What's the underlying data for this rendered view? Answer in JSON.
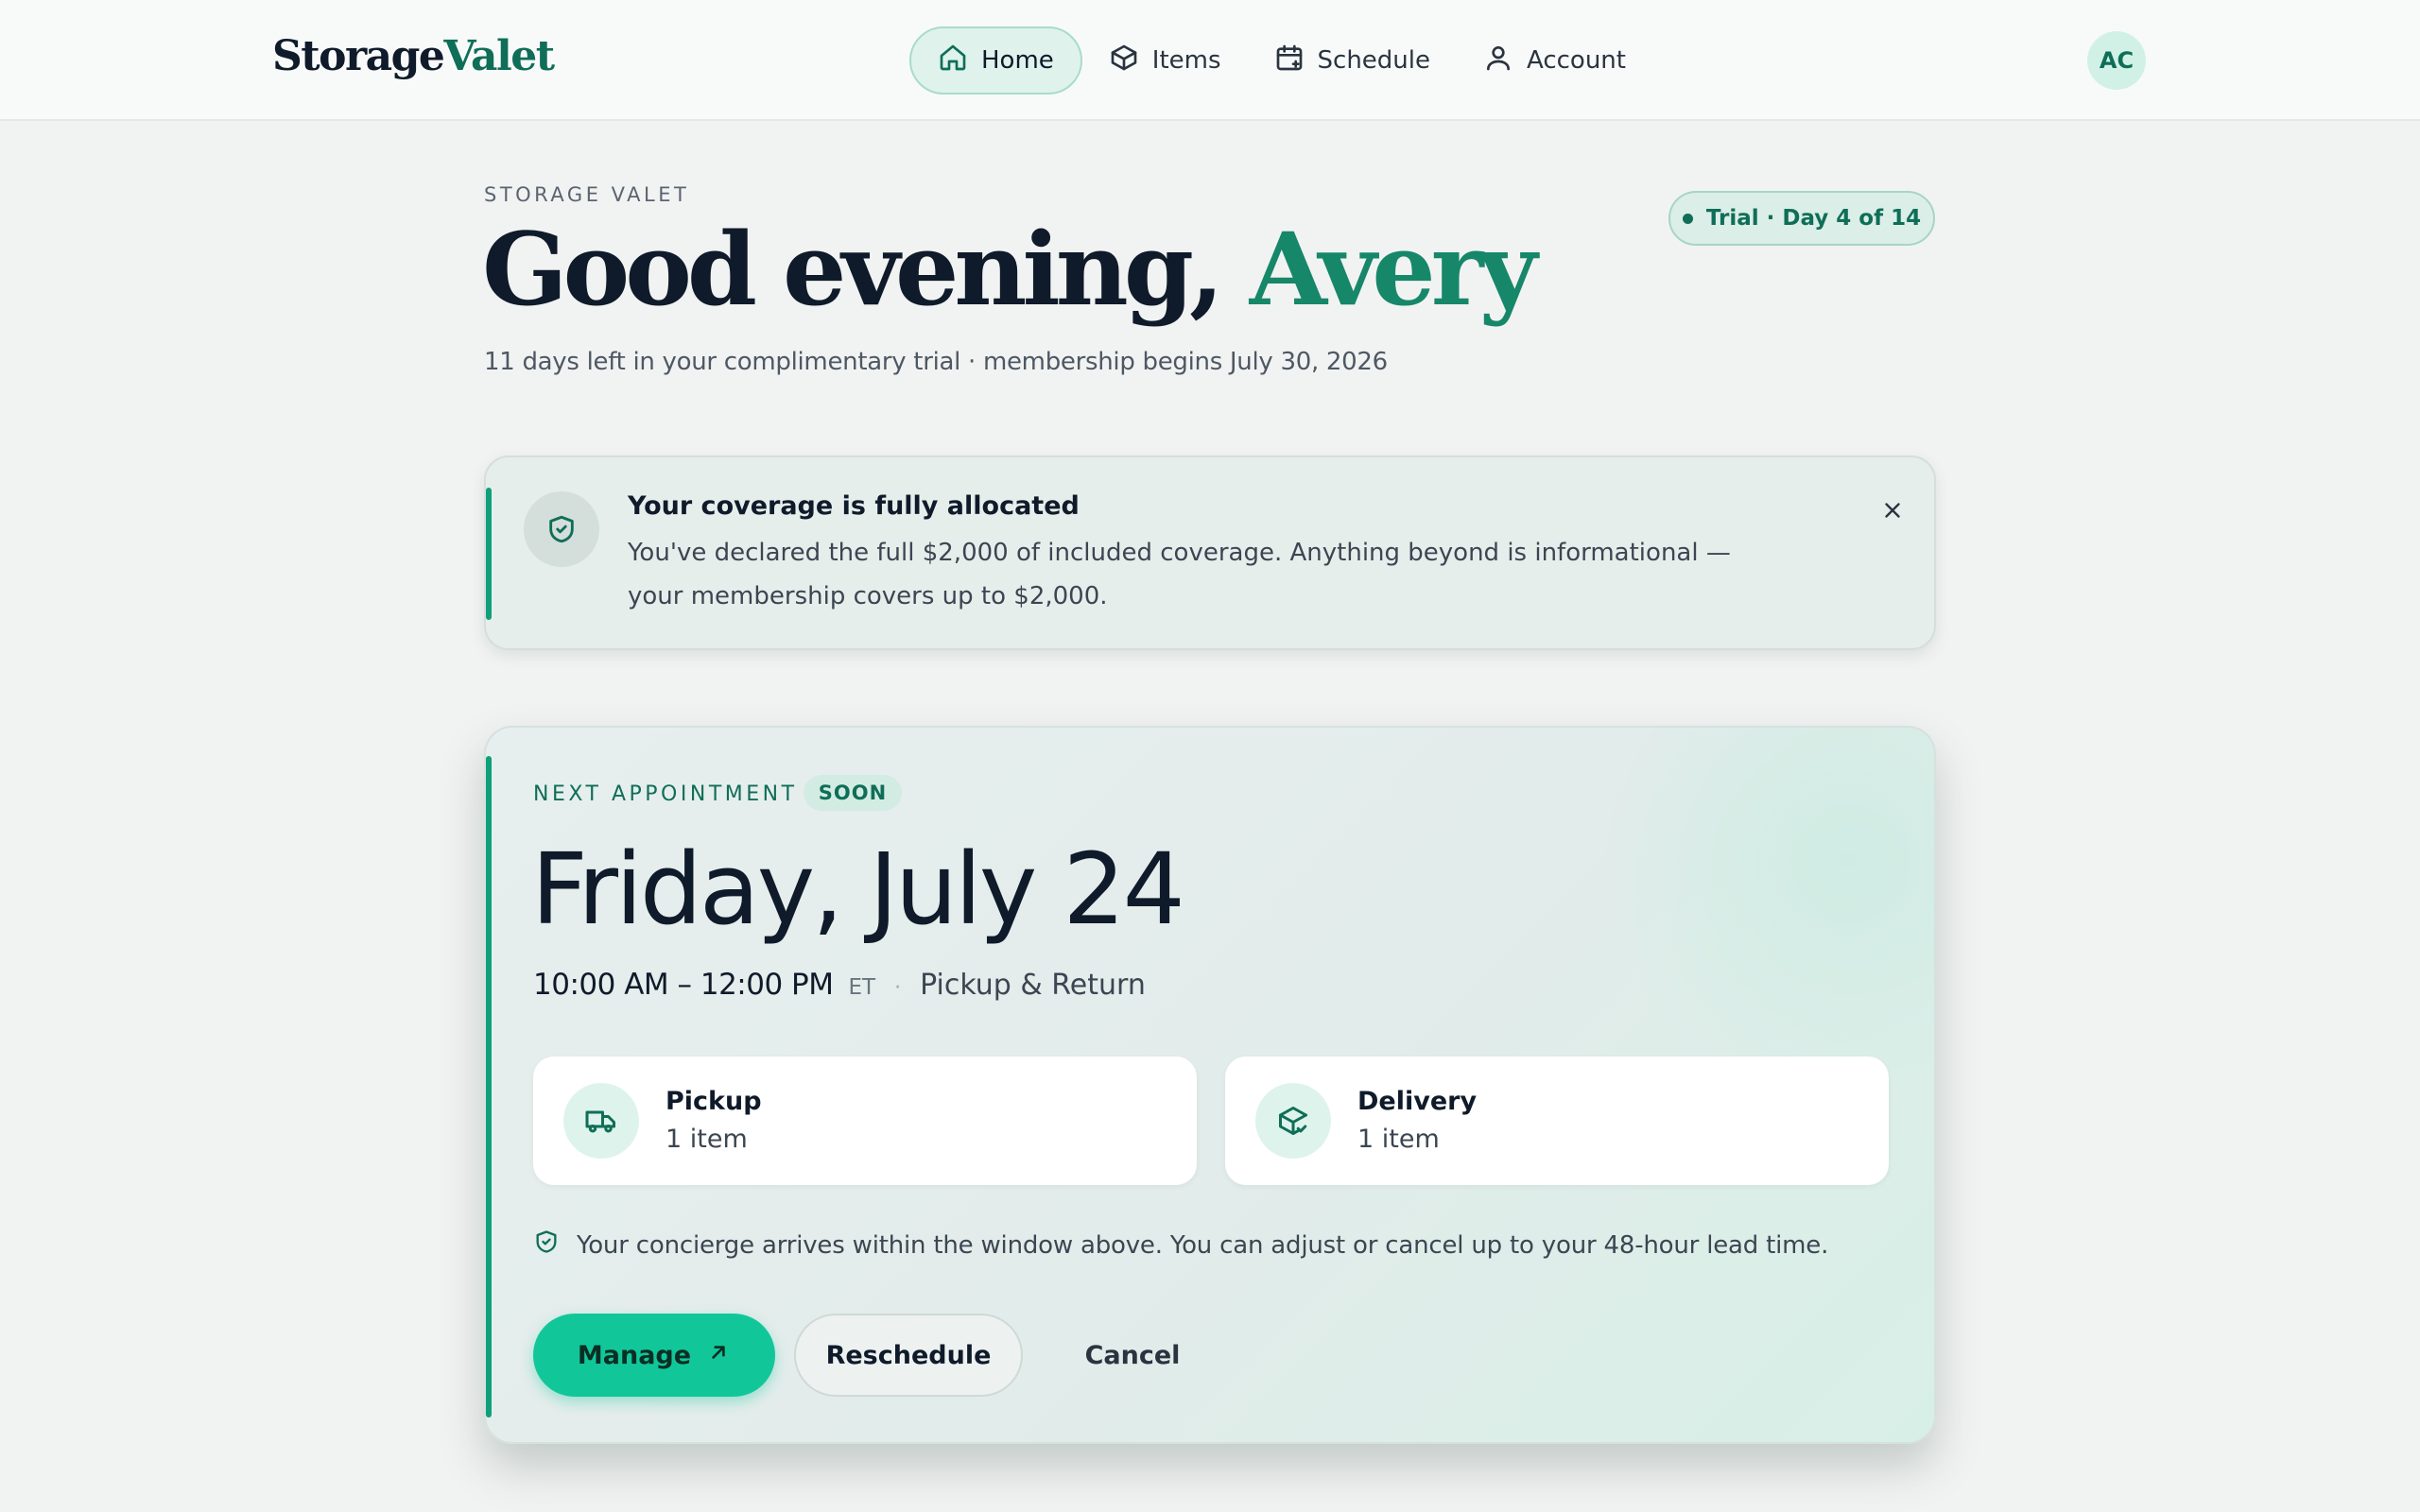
{
  "header": {
    "logo": {
      "part1": "Storage",
      "part2": "Valet"
    },
    "nav": [
      {
        "label": "Home",
        "icon": "home-icon",
        "active": true
      },
      {
        "label": "Items",
        "icon": "box-icon",
        "active": false
      },
      {
        "label": "Schedule",
        "icon": "calendar-icon",
        "active": false
      },
      {
        "label": "Account",
        "icon": "user-icon",
        "active": false
      }
    ],
    "avatar_initials": "AC"
  },
  "greeting": {
    "eyebrow": "STORAGE VALET",
    "salutation": "Good evening,",
    "name": "Avery",
    "subline": "11 days left in your complimentary trial · membership begins July 30, 2026",
    "trial_badge": "Trial · Day 4 of 14"
  },
  "alert": {
    "icon": "shield-check-icon",
    "title": "Your coverage is fully allocated",
    "body": "You've declared the full $2,000 of included coverage. Anything beyond is informational — your membership covers up to $2,000.",
    "close_icon": "close-icon"
  },
  "appointment": {
    "label": "NEXT APPOINTMENT",
    "badge": "SOON",
    "date": "Friday, July 24",
    "time": "10:00 AM – 12:00 PM",
    "timezone": "ET",
    "separator": "·",
    "service": "Pickup & Return",
    "tiles": [
      {
        "title": "Pickup",
        "value": "1 item",
        "icon": "truck-icon"
      },
      {
        "title": "Delivery",
        "value": "1 item",
        "icon": "package-check-icon"
      }
    ],
    "note": "Your concierge arrives within the window above. You can adjust or cancel up to your 48-hour lead time.",
    "buttons": {
      "manage": "Manage",
      "reschedule": "Reschedule",
      "cancel": "Cancel"
    }
  },
  "colors": {
    "accent": "#0f6e57",
    "accent_bright": "#11c79a",
    "ink": "#0f1a2a",
    "background": "#f1f3f2"
  }
}
